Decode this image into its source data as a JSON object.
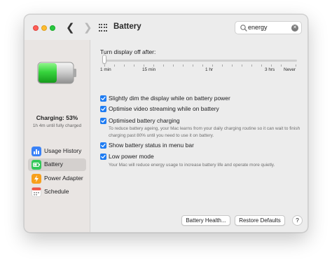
{
  "window": {
    "title": "Battery"
  },
  "search": {
    "value": "energy"
  },
  "sidebar": {
    "charging_label": "Charging: 53%",
    "charged_time": "1h 4m until fully charged",
    "battery_level": 0.53,
    "items": [
      {
        "label": "Usage History",
        "icon": "usage-history-icon",
        "color": "#3a82f7"
      },
      {
        "label": "Battery",
        "icon": "battery-icon",
        "color": "#33c759"
      },
      {
        "label": "Power Adapter",
        "icon": "power-adapter-icon",
        "color": "#f7a01c"
      },
      {
        "label": "Schedule",
        "icon": "schedule-icon",
        "color": "#ffffff"
      }
    ]
  },
  "display_off": {
    "title": "Turn display off after:",
    "ticks": [
      "1 min",
      "15 min",
      "1 hr",
      "3 hrs",
      "Never"
    ],
    "value": "1 min"
  },
  "options": [
    {
      "label": "Slightly dim the display while on battery power",
      "checked": true
    },
    {
      "label": "Optimise video streaming while on battery",
      "checked": true
    },
    {
      "label": "Optimised battery charging",
      "checked": true,
      "description": "To reduce battery ageing, your Mac learns from your daily charging routine so it can wait to finish charging past 80% until you need to use it on battery."
    },
    {
      "label": "Show battery status in menu bar",
      "checked": true
    },
    {
      "label": "Low power mode",
      "checked": true,
      "description": "Your Mac will reduce energy usage to increase battery life and operate more quietly."
    }
  ],
  "buttons": {
    "battery_health": "Battery Health...",
    "restore_defaults": "Restore Defaults",
    "help": "?"
  },
  "colors": {
    "accent": "#1f7cf2",
    "battery_green": "#33c759"
  }
}
